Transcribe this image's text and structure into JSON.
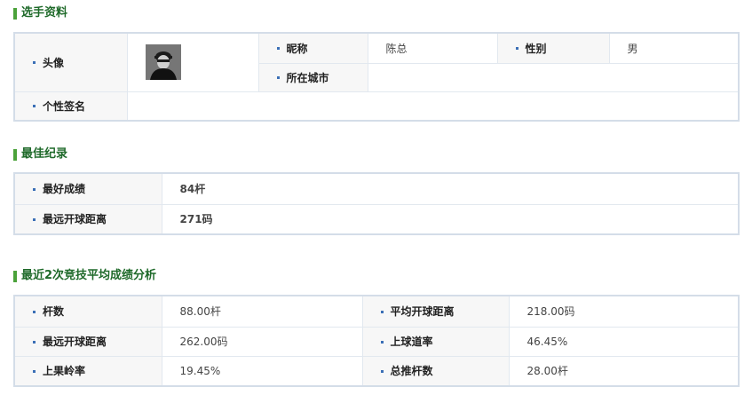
{
  "profile": {
    "title": "选手资料",
    "avatar_label": "头像",
    "nickname_label": "昵称",
    "nickname": "陈总",
    "gender_label": "性别",
    "gender": "男",
    "city_label": "所在城市",
    "city": "",
    "signature_label": "个性签名",
    "signature": ""
  },
  "best": {
    "title": "最佳纪录",
    "best_score_label": "最好成绩",
    "best_score": "84杆",
    "longest_drive_label": "最远开球距离",
    "longest_drive": "271码"
  },
  "recent": {
    "title": "最近2次竞技平均成绩分析",
    "rows": [
      {
        "l1": "杆数",
        "v1": "88.00杆",
        "l2": "平均开球距离",
        "v2": "218.00码"
      },
      {
        "l1": "最远开球距离",
        "v1": "262.00码",
        "l2": "上球道率",
        "v2": "46.45%"
      },
      {
        "l1": "上果岭率",
        "v1": "19.45%",
        "l2": "总推杆数",
        "v2": "28.00杆"
      }
    ]
  }
}
